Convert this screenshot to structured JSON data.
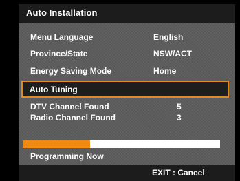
{
  "title": "Auto Installation",
  "settings": [
    {
      "label": "Menu Language",
      "value": "English"
    },
    {
      "label": "Province/State",
      "value": "NSW/ACT"
    },
    {
      "label": "Energy Saving Mode",
      "value": "Home"
    }
  ],
  "selected_item": "Auto Tuning",
  "results": [
    {
      "label": "DTV Channel Found",
      "count": "5"
    },
    {
      "label": "Radio Channel Found",
      "count": "3"
    }
  ],
  "progress": {
    "fraction": 0.34,
    "track_color": "#ffffff",
    "fill_color": "#f08a10"
  },
  "status_text": "Programming Now",
  "footer": {
    "exit_label": "EXIT : Cancel"
  },
  "colors": {
    "highlight_border": "#e38a1c",
    "panel_bg": "#5c5c5c",
    "title_bg": "#1c1c1c"
  }
}
